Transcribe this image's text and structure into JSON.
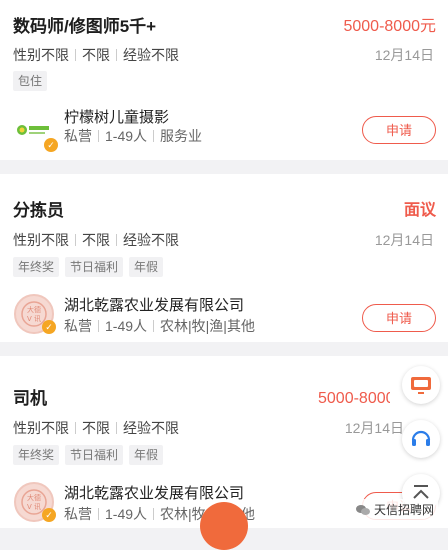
{
  "jobs": [
    {
      "title": "数码师/修图师5千+",
      "salary": "5000-8000元",
      "req": [
        "性别不限",
        "不限",
        "经验不限"
      ],
      "date": "12月14日",
      "tags": [
        "包住"
      ],
      "company": "柠檬树儿童摄影",
      "company_meta": [
        "私营",
        "1-49人",
        "服务业"
      ],
      "apply": "申请"
    },
    {
      "title": "分拣员",
      "salary": "面议",
      "req": [
        "性别不限",
        "不限",
        "经验不限"
      ],
      "date": "12月14日",
      "tags": [
        "年终奖",
        "节日福利",
        "年假"
      ],
      "company": "湖北乾露农业发展有限公司",
      "company_meta": [
        "私营",
        "1-49人",
        "农林|牧|渔|其他"
      ],
      "apply": "申请"
    },
    {
      "title": "司机",
      "salary": "5000-8000元",
      "req": [
        "性别不限",
        "不限",
        "经验不限"
      ],
      "date": "12月14日",
      "tags": [
        "年终奖",
        "节日福利",
        "年假"
      ],
      "company": "湖北乾露农业发展有限公司",
      "company_meta": [
        "私营",
        "1-49人",
        "农林|牧|渔|其他"
      ],
      "apply": "申请"
    }
  ],
  "watermark": "天信招聘网",
  "colors": {
    "accent": "#ef5b4c",
    "fab": "#f06a3c"
  }
}
